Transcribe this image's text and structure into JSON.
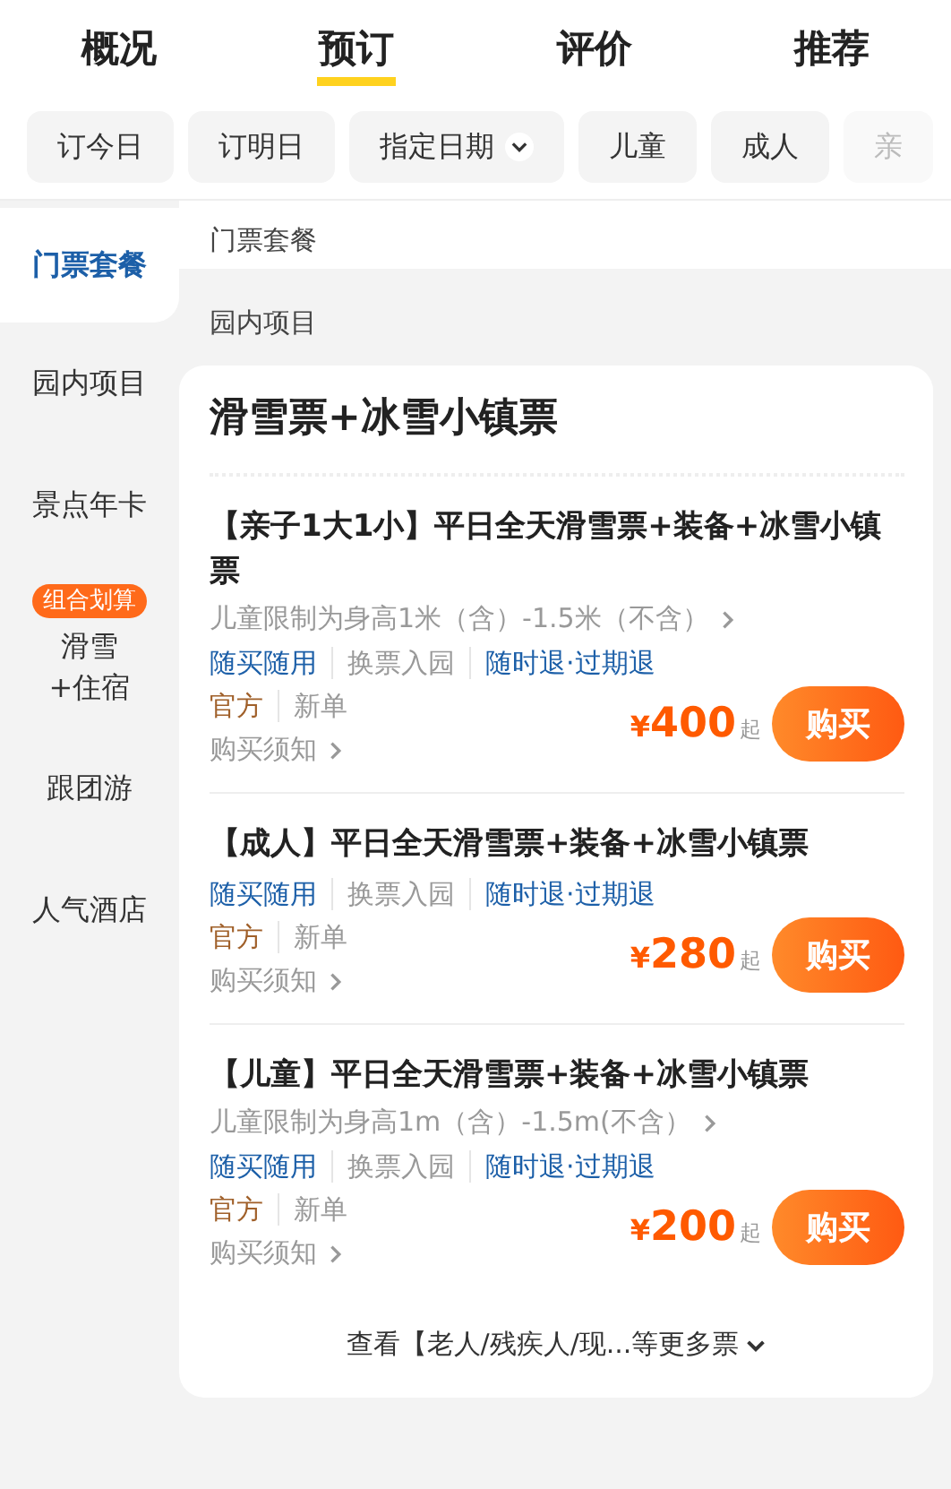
{
  "tabs": [
    {
      "label": "概况",
      "selected": false
    },
    {
      "label": "预订",
      "selected": true
    },
    {
      "label": "评价",
      "selected": false
    },
    {
      "label": "推荐",
      "selected": false
    }
  ],
  "filters": [
    {
      "label": "订今日",
      "dropdown": false,
      "faded": false
    },
    {
      "label": "订明日",
      "dropdown": false,
      "faded": false
    },
    {
      "label": "指定日期",
      "dropdown": true,
      "faded": false
    },
    {
      "label": "儿童",
      "dropdown": false,
      "faded": false
    },
    {
      "label": "成人",
      "dropdown": false,
      "faded": false
    },
    {
      "label": "亲",
      "dropdown": false,
      "faded": true
    }
  ],
  "sidebar": {
    "items": [
      {
        "label": "门票套餐",
        "selected": true
      },
      {
        "label": "园内项目",
        "selected": false
      },
      {
        "label": "景点年卡",
        "selected": false
      },
      {
        "label": "滑雪\n+住宿",
        "badge": "组合划算",
        "selected": false
      },
      {
        "label": "跟团游",
        "selected": false
      },
      {
        "label": "人气酒店",
        "selected": false
      }
    ]
  },
  "sections": [
    {
      "title": "门票套餐"
    },
    {
      "title": "园内项目"
    }
  ],
  "card": {
    "title": "滑雪票+冰雪小镇票",
    "products": [
      {
        "name": "【亲子1大1小】平日全天滑雪票+装备+冰雪小镇票",
        "restriction": "儿童限制为身高1米（含）-1.5米（不含）",
        "tags": [
          {
            "label": "随买随用",
            "kind": "feature"
          },
          {
            "label": "换票入园",
            "kind": "plain"
          },
          {
            "label": "随时退·过期退",
            "kind": "feature"
          }
        ],
        "badges": [
          {
            "label": "官方",
            "kind": "official"
          },
          {
            "label": "新单",
            "kind": "plain"
          }
        ],
        "notice": "购买须知",
        "currency": "¥",
        "price": "400",
        "suffix": "起",
        "button": "购买"
      },
      {
        "name": "【成人】平日全天滑雪票+装备+冰雪小镇票",
        "tags": [
          {
            "label": "随买随用",
            "kind": "feature"
          },
          {
            "label": "换票入园",
            "kind": "plain"
          },
          {
            "label": "随时退·过期退",
            "kind": "feature"
          }
        ],
        "badges": [
          {
            "label": "官方",
            "kind": "official"
          },
          {
            "label": "新单",
            "kind": "plain"
          }
        ],
        "notice": "购买须知",
        "currency": "¥",
        "price": "280",
        "suffix": "起",
        "button": "购买"
      },
      {
        "name": "【儿童】平日全天滑雪票+装备+冰雪小镇票",
        "restriction": "儿童限制为身高1m（含）-1.5m(不含）",
        "tags": [
          {
            "label": "随买随用",
            "kind": "feature"
          },
          {
            "label": "换票入园",
            "kind": "plain"
          },
          {
            "label": "随时退·过期退",
            "kind": "feature"
          }
        ],
        "badges": [
          {
            "label": "官方",
            "kind": "official"
          },
          {
            "label": "新单",
            "kind": "plain"
          }
        ],
        "notice": "购买须知",
        "currency": "¥",
        "price": "200",
        "suffix": "起",
        "button": "购买"
      }
    ],
    "more": "查看【老人/残疾人/现...等更多票"
  }
}
